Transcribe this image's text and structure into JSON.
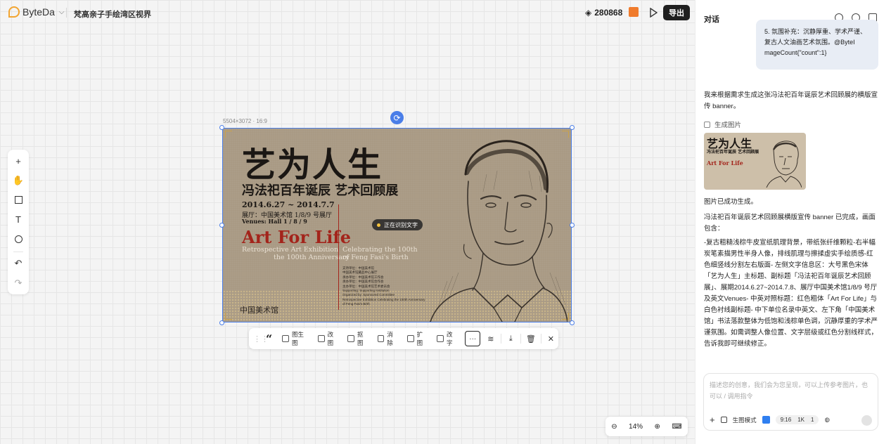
{
  "topbar": {
    "brand": "ByteDa",
    "project_title": "梵高亲子手绘湾区视界",
    "points": "280868",
    "export_label": "导出"
  },
  "canvas": {
    "dimensions_label": "5504×3072 · 16:9",
    "ocr_status": "正在识别文字",
    "zoom": "14%"
  },
  "poster": {
    "title": "艺为人生",
    "subtitle": "冯法祀百年诞辰 艺术回顾展",
    "date": "2014.6.27 ~ 2014.7.7",
    "venue": "展厅：中国美术馆 1/8/9 号展厅",
    "venue_en": "Venues: Hall 1 / 8 / 9",
    "art_title": "Art For Life",
    "retro": "Retrospective Art Exhibition",
    "anniversary": "the 100th Anniversary",
    "celebrating_1": "Celebrating the 100th",
    "celebrating_2": "of Feng Fasi's Birth",
    "credits": [
      "支持单位：中国美术馆",
      "中国美术馆藏品中心展厅",
      "承办单位：中国美术馆工作会",
      "承办单位：中国美术馆合作会",
      "主办单位：中国美术馆艺术委员会",
      "Supporting: Supporting Institution",
      "Organized by: Sponsored Committee",
      "Retrospective Exhibition Celebrating the 100th Anniversary",
      "of Feng Fasi's Birth"
    ],
    "logo_text": "中国美术馆"
  },
  "action_toolbar": {
    "items": [
      "图生图",
      "改图",
      "抠图",
      "消除",
      "扩图",
      "改字"
    ]
  },
  "panel": {
    "title": "对话",
    "bubble_lines": [
      "5. 氛围补充：沉静厚重、学术严谨、",
      "复古人文油画艺术氛围。@ByteI",
      "mageCount{\"count\":1}"
    ],
    "reply_intro": "我来根据需求生成这张冯法祀百年诞辰艺术回顾展的横版宣传 banner。",
    "gen_label": "生成图片",
    "thumb_title": "艺为人生",
    "thumb_sub": "冯法祀百年诞辰 艺术回顾展",
    "thumb_art": "Art For Life",
    "success": "图片已成功生成。",
    "summary": "冯法祀百年诞辰艺术回顾展横版宣传 banner 已完成，画面包含：",
    "details": "-复古粗糙浅棕牛皮宣纸肌理背景，带纸张纤维颗粒-右半幅炭笔素描男性半身人像，排线肌理与擦揉虚实手绘质感-红色细竖线分割左右版面- 左侧文字信息区：大号黑色宋体「艺为人生」主标题、副标题「冯法祀百年诞辰艺术回顾展」、展期2014.6.27~2014.7.8、展厅中国美术馆1/8/9 号厅及英文Venues- 中英对照标题：红色粗体「Art For Life」与白色衬线副标题- 中下单位名录中英文、左下角「中国美术馆」书法落款整体为低饱和浅棕单色调，沉静厚重的学术严谨氛围。如需调整人像位置、文字层级或红色分割线样式，告诉我即可继续修正。",
    "input_placeholder": "描述您的创意，我们会为您呈现，可以上传参考图片，也可以 / 调用指令",
    "mode_label": "生图模式",
    "ratio": "9:16",
    "resolution": "1K",
    "count": "1"
  },
  "colors": {
    "accent_blue": "#4a7ee8",
    "poster_bg": "#a99a84",
    "poster_red": "#a3241b",
    "export_bg": "#1f1f1f"
  }
}
